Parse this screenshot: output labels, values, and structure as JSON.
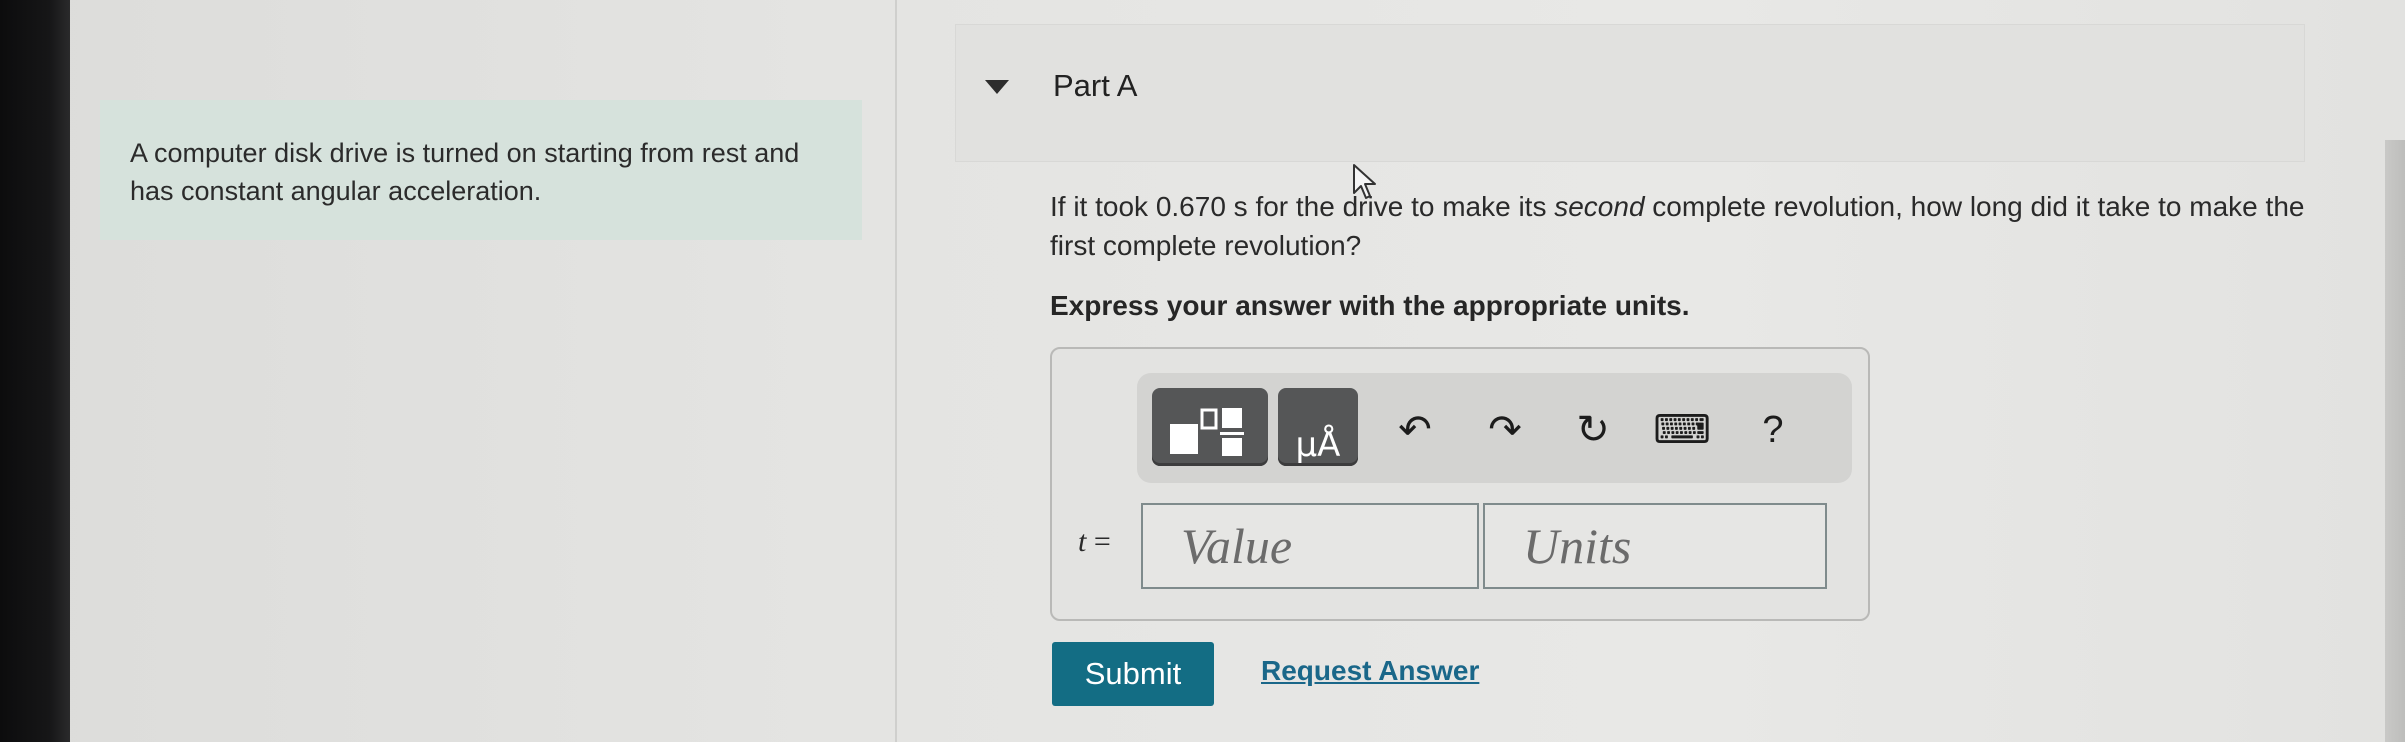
{
  "intro": {
    "text": "A computer disk drive is turned on starting from rest and has constant angular acceleration."
  },
  "part": {
    "title": "Part A",
    "question_before": "If it took 0.670 s for the drive to make its ",
    "question_emphasis": "second",
    "question_after": " complete revolution, how long did it take to make the first complete revolution?",
    "instruction": "Express your answer with the appropriate units."
  },
  "toolbar": {
    "templates_icon": "templates-icon",
    "units_icon": "units-icon",
    "units_glyph": "μÅ",
    "undo_glyph": "↶",
    "redo_glyph": "↷",
    "reset_glyph": "↻",
    "keyboard_glyph": "⌨",
    "help_glyph": "?"
  },
  "answer": {
    "variable": "t",
    "equals": " =",
    "value_placeholder": "Value",
    "units_placeholder": "Units"
  },
  "actions": {
    "submit_label": "Submit",
    "request_answer_label": "Request Answer"
  },
  "colors": {
    "intro_bg": "#d6e2dc",
    "submit_bg": "#136d84",
    "link": "#1a6789"
  }
}
